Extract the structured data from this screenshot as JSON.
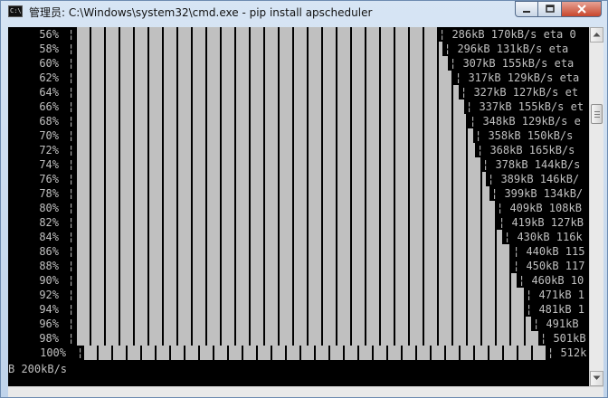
{
  "window": {
    "title": "管理员: C:\\Windows\\system32\\cmd.exe - pip  install apscheduler",
    "icon": "cmd-icon",
    "icon_text": "C:\\",
    "controls": {
      "minimize": "minimize-icon",
      "maximize": "maximize-icon",
      "close": "close-icon"
    }
  },
  "console": {
    "background": "#000000",
    "foreground": "#c0c0c0",
    "rows": [
      {
        "pct": "56%",
        "progress": 0.56,
        "status": "¦ 286kB 170kB/s eta 0"
      },
      {
        "pct": "58%",
        "progress": 0.58,
        "status": "¦ 296kB 131kB/s eta"
      },
      {
        "pct": "60%",
        "progress": 0.6,
        "status": "¦ 307kB 155kB/s eta"
      },
      {
        "pct": "62%",
        "progress": 0.62,
        "status": "¦ 317kB 129kB/s eta"
      },
      {
        "pct": "64%",
        "progress": 0.64,
        "status": "¦ 327kB 127kB/s et"
      },
      {
        "pct": "66%",
        "progress": 0.66,
        "status": "¦ 337kB 155kB/s et"
      },
      {
        "pct": "68%",
        "progress": 0.68,
        "status": "¦ 348kB 129kB/s e"
      },
      {
        "pct": "70%",
        "progress": 0.7,
        "status": "¦ 358kB 150kB/s"
      },
      {
        "pct": "72%",
        "progress": 0.72,
        "status": "¦ 368kB 165kB/s"
      },
      {
        "pct": "74%",
        "progress": 0.74,
        "status": "¦ 378kB 144kB/s"
      },
      {
        "pct": "76%",
        "progress": 0.76,
        "status": "¦ 389kB 146kB/"
      },
      {
        "pct": "78%",
        "progress": 0.78,
        "status": "¦ 399kB 134kB/"
      },
      {
        "pct": "80%",
        "progress": 0.8,
        "status": "¦ 409kB 108kB"
      },
      {
        "pct": "82%",
        "progress": 0.82,
        "status": "¦ 419kB 127kB"
      },
      {
        "pct": "84%",
        "progress": 0.84,
        "status": "¦ 430kB 116k"
      },
      {
        "pct": "86%",
        "progress": 0.86,
        "status": "¦ 440kB 115"
      },
      {
        "pct": "88%",
        "progress": 0.88,
        "status": "¦ 450kB 117"
      },
      {
        "pct": "90%",
        "progress": 0.9,
        "status": "¦ 460kB 10"
      },
      {
        "pct": "92%",
        "progress": 0.92,
        "status": "¦ 471kB 1"
      },
      {
        "pct": "94%",
        "progress": 0.94,
        "status": "¦ 481kB 1"
      },
      {
        "pct": "96%",
        "progress": 0.96,
        "status": "¦ 491kB"
      },
      {
        "pct": "98%",
        "progress": 0.98,
        "status": "¦ 501kB"
      },
      {
        "pct": "100%",
        "progress": 1.0,
        "status": "¦ 512k"
      }
    ],
    "bracket_char": "¦",
    "tail_line": "B 200kB/s"
  },
  "scrollbar": {
    "up": "scroll-up-icon",
    "down": "scroll-down-icon",
    "position": 0.2
  }
}
